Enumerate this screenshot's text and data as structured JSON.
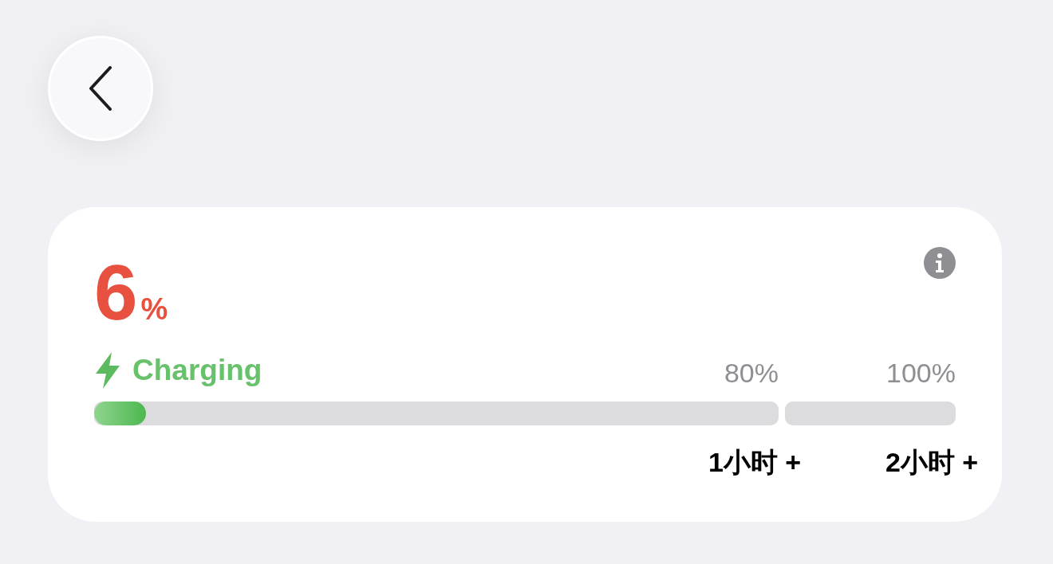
{
  "battery": {
    "percent": "6",
    "unit": "%",
    "status": "Charging",
    "level": 0.06,
    "segments": [
      {
        "label": "80%",
        "time": "1小时 +"
      },
      {
        "label": "100%",
        "time": "2小时 +"
      }
    ]
  }
}
